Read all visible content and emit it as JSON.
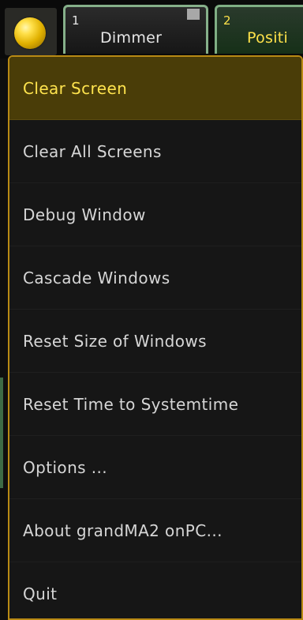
{
  "app": {
    "brand_button": {
      "icon": "grandma-ball-icon"
    }
  },
  "tabs": [
    {
      "number": "1",
      "label": "Dimmer"
    },
    {
      "number": "2",
      "label": "Positi"
    }
  ],
  "menu": {
    "items": [
      {
        "label": "Clear Screen",
        "active": true
      },
      {
        "label": "Clear All Screens"
      },
      {
        "label": "Debug Window"
      },
      {
        "label": "Cascade Windows"
      },
      {
        "label": "Reset Size of Windows"
      },
      {
        "label": "Reset Time to Systemtime"
      },
      {
        "label": "Options ..."
      },
      {
        "label": "About grandMA2 onPC..."
      },
      {
        "label": "Quit"
      }
    ]
  },
  "colors": {
    "accent_yellow": "#ffe44e",
    "menu_border": "#b88a14",
    "tab_border": "#86b08a",
    "active_bg": "#4a3d08"
  }
}
